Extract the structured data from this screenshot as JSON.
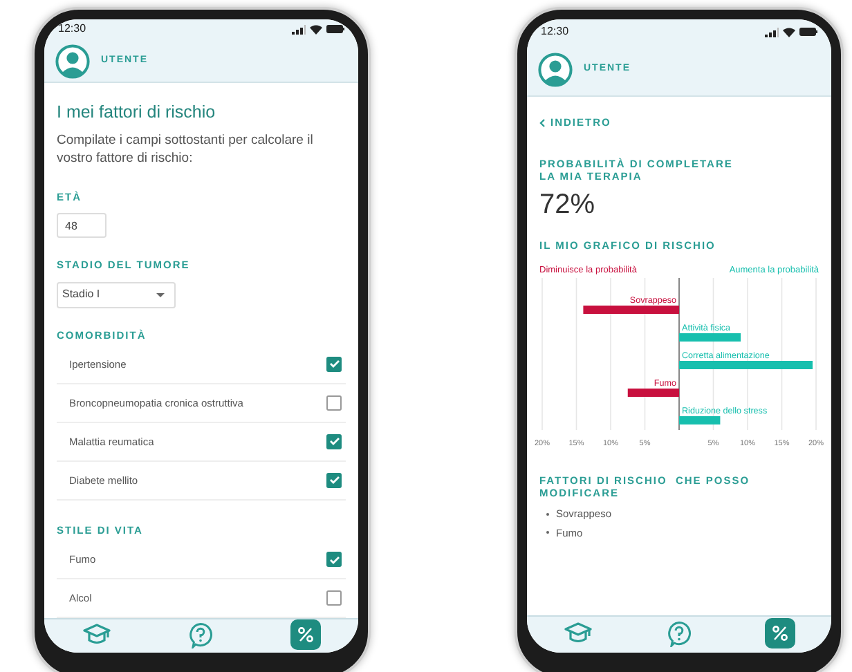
{
  "screens": [
    {
      "kind": "form",
      "status_bar": {
        "time": "12:30"
      },
      "header": {
        "user_label": "UTENTE"
      },
      "title": "I mei fattori di rischio",
      "intro": "Compilate i campi sottostanti per calcolare il vostro fattore di rischio:",
      "age": {
        "label": "ETÀ",
        "value": "48"
      },
      "stage": {
        "label": "STADIO DEL TUMORE",
        "value": "Stadio I"
      },
      "sections": [
        {
          "title": "COMORBIDITÀ",
          "items": [
            {
              "label": "Ipertensione",
              "checked": true
            },
            {
              "label": "Broncopneumopatia cronica ostruttiva",
              "checked": false
            },
            {
              "label": "Malattia reumatica",
              "checked": true
            },
            {
              "label": "Diabete mellito",
              "checked": true
            }
          ]
        },
        {
          "title": "STILE DI VITA",
          "items": [
            {
              "label": "Fumo",
              "checked": true
            },
            {
              "label": "Alcol",
              "checked": false
            }
          ]
        }
      ],
      "nav": [
        {
          "kind": "learn",
          "selected": false
        },
        {
          "kind": "help",
          "selected": false
        },
        {
          "kind": "percent",
          "selected": true
        }
      ]
    },
    {
      "kind": "result",
      "status_bar": {
        "time": "12:30"
      },
      "header": {
        "user_label": "UTENTE"
      },
      "back": "INDIETRO",
      "probability_title": "PROBABILITÀ DI COMPLETARE LA MIA TERAPIA",
      "probability": "72%",
      "chart_title": "IL MIO GRAFICO DI RISCHIO",
      "chart_data": {
        "type": "bar",
        "orientation": "horizontal",
        "grid": true,
        "categories": [
          "Sovrappeso",
          "Attività fisica",
          "Corretta alimentazione",
          "Fumo",
          "Riduzione dello stress"
        ],
        "series": [
          {
            "name": "Diminuisce la probabilità",
            "color": "#c8103e",
            "values": [
              -14,
              null,
              null,
              -7.5,
              null
            ]
          },
          {
            "name": "Aumenta la probabilità",
            "color": "#17bfae",
            "values": [
              null,
              9,
              19.5,
              null,
              6
            ]
          }
        ],
        "xlim": [
          -20,
          20
        ],
        "xticks": [
          {
            "value": -20,
            "label": "20%"
          },
          {
            "value": -15,
            "label": "15%"
          },
          {
            "value": -10,
            "label": "10%"
          },
          {
            "value": -5,
            "label": "5%"
          },
          {
            "value": 5,
            "label": "5%"
          },
          {
            "value": 10,
            "label": "10%"
          },
          {
            "value": 15,
            "label": "15%"
          },
          {
            "value": 20,
            "label": "20%"
          }
        ]
      },
      "modifiable_title": "FATTORI DI RISCHIO  CHE POSSO MODIFICARE",
      "modifiable": [
        "Sovrappeso",
        "Fumo"
      ],
      "nav": [
        {
          "kind": "learn",
          "selected": false
        },
        {
          "kind": "help",
          "selected": false
        },
        {
          "kind": "percent",
          "selected": true
        }
      ]
    }
  ]
}
